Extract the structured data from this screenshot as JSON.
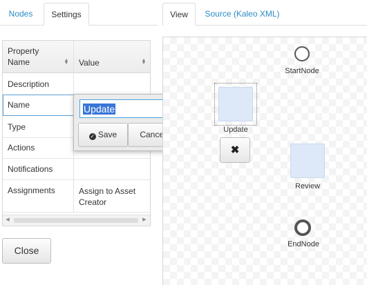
{
  "left_tabs": [
    {
      "label": "Nodes",
      "active": false
    },
    {
      "label": "Settings",
      "active": true
    }
  ],
  "right_tabs": [
    {
      "label": "View",
      "active": true
    },
    {
      "label": "Source (Kaleo XML)",
      "active": false
    }
  ],
  "grid": {
    "headers": {
      "property": "Property Name",
      "value": "Value"
    },
    "rows": [
      {
        "property": "Description",
        "value": ""
      },
      {
        "property": "Name",
        "value": "Update"
      },
      {
        "property": "Type",
        "value": ""
      },
      {
        "property": "Actions",
        "value": ""
      },
      {
        "property": "Notifications",
        "value": ""
      },
      {
        "property": "Assignments",
        "value": "Assign to Asset Creator"
      }
    ]
  },
  "editor": {
    "value": "Update",
    "save_label": "Save",
    "cancel_label": "Cancel"
  },
  "close_label": "Close",
  "diagram": {
    "nodes": [
      {
        "name": "StartNode",
        "type": "start"
      },
      {
        "name": "Update",
        "type": "task",
        "selected": true
      },
      {
        "name": "Review",
        "type": "task"
      },
      {
        "name": "EndNode",
        "type": "end"
      }
    ],
    "delete_icon": "times-icon"
  },
  "colors": {
    "link": "#2a8cc6",
    "task_fill": "#dde8f8",
    "selection": "#3875d7",
    "input_border": "#4aa2dc"
  }
}
